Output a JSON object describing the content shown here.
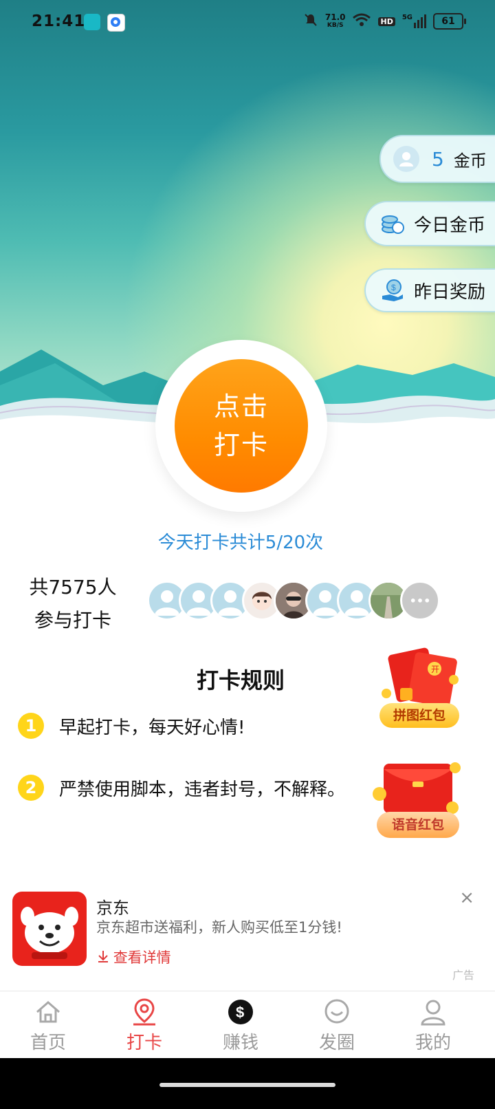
{
  "status_bar": {
    "time": "21:41",
    "network_speed_value": "71.0",
    "network_speed_unit": "KB/S",
    "hd": "HD",
    "signal": "5G",
    "battery": "61"
  },
  "side_pills": {
    "coins_count": "5",
    "coins_label": "金币",
    "today_coins": "今日金币",
    "yesterday_reward": "昨日奖励"
  },
  "checkin": {
    "button_line1": "点击",
    "button_line2": "打卡",
    "today_count": "今天打卡共计5/20次",
    "participants_line1": "共7575人",
    "participants_line2": "参与打卡",
    "more_avatars": "•••"
  },
  "rules": {
    "title": "打卡规则",
    "items": [
      {
        "num": "1",
        "text": "早起打卡，每天好心情!"
      },
      {
        "num": "2",
        "text": "严禁使用脚本，违者封号，不解释。"
      }
    ],
    "puzzle_redpack_label": "拼图红包",
    "voice_redpack_label": "语音红包",
    "redpack_open_char": "开"
  },
  "ad": {
    "title": "京东",
    "description": "京东超市送福利，新人购买低至1分钱!",
    "link": "查看详情",
    "tag": "广告",
    "close": "×"
  },
  "tabbar": {
    "items": [
      {
        "label": "首页",
        "icon": "home-icon"
      },
      {
        "label": "打卡",
        "icon": "location-pin-icon",
        "active": true
      },
      {
        "label": "赚钱",
        "icon": "dollar-icon"
      },
      {
        "label": "发圈",
        "icon": "chat-bubble-icon"
      },
      {
        "label": "我的",
        "icon": "person-icon"
      }
    ]
  },
  "colors": {
    "accent_orange": "#ff8c00",
    "active_tab": "#e84545",
    "count_blue": "#2a8bd6",
    "rule_badge": "#ffd51a"
  }
}
